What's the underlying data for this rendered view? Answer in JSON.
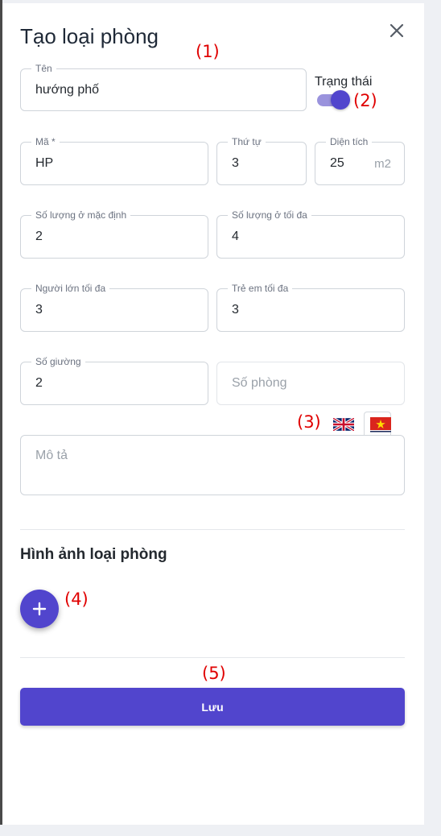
{
  "dialog": {
    "title": "Tạo loại phòng"
  },
  "annotations": {
    "a1": "(1)",
    "a2": "(2)",
    "a3": "(3)",
    "a4": "(4)",
    "a5": "(5)"
  },
  "form": {
    "name": {
      "label": "Tên",
      "value": "hướng phố"
    },
    "status": {
      "label": "Trạng thái",
      "on": true
    },
    "code": {
      "label": "Mã *",
      "value": "HP"
    },
    "order": {
      "label": "Thứ tự",
      "value": "3"
    },
    "area": {
      "label": "Diện tích",
      "value": "25",
      "unit": "m2"
    },
    "default_occupancy": {
      "label": "Số lượng ở mặc định",
      "value": "2"
    },
    "max_occupancy": {
      "label": "Số lượng ở tối đa",
      "value": "4"
    },
    "max_adults": {
      "label": "Người lớn tối đa",
      "value": "3"
    },
    "max_children": {
      "label": "Trẻ em tối đa",
      "value": "3"
    },
    "beds": {
      "label": "Số giường",
      "value": "2"
    },
    "rooms": {
      "placeholder": "Số phòng"
    },
    "description": {
      "placeholder": "Mô tả"
    }
  },
  "languages": [
    {
      "icon": "uk-flag-icon",
      "active": false
    },
    {
      "icon": "vietnam-flag-icon",
      "active": true
    }
  ],
  "images_section": {
    "title": "Hình ảnh loại phòng"
  },
  "actions": {
    "save_label": "Lưu"
  },
  "colors": {
    "primary": "#5145cd",
    "annotation": "#e00000"
  }
}
